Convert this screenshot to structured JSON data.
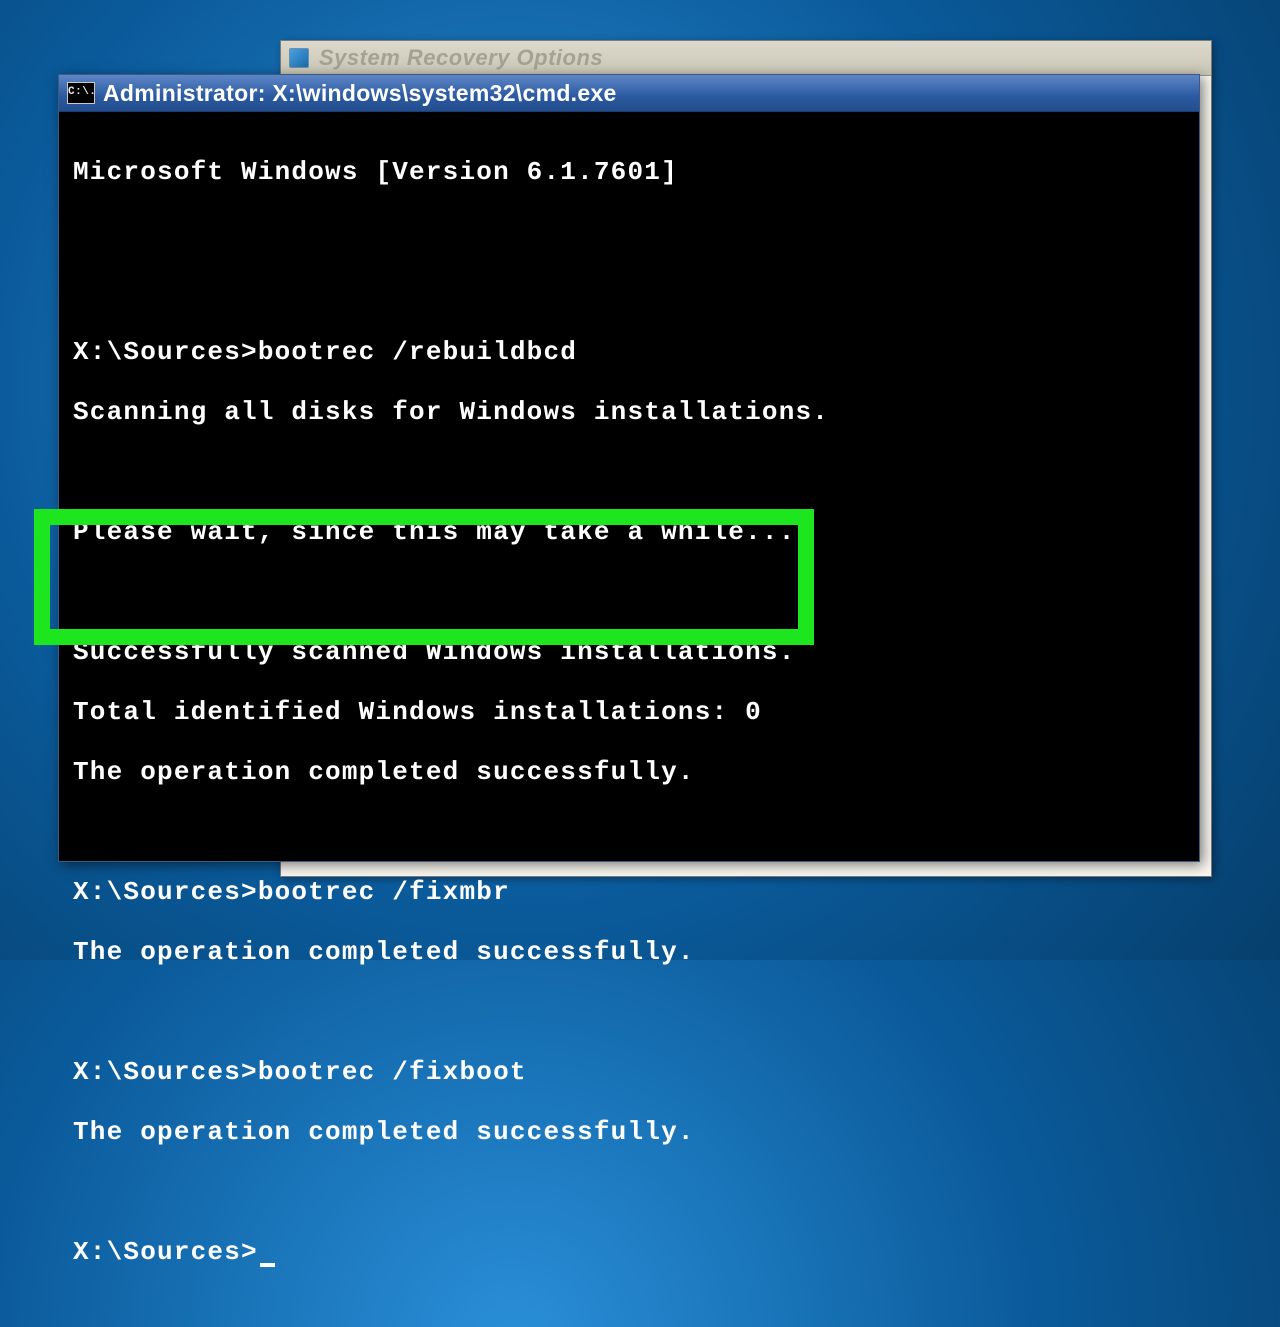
{
  "background_window": {
    "title": "System Recovery Options"
  },
  "cmd_window": {
    "icon_text": "C:\\.",
    "title": "Administrator: X:\\windows\\system32\\cmd.exe"
  },
  "terminal": {
    "lines": [
      "Microsoft Windows [Version 6.1.7601]",
      "",
      "",
      "X:\\Sources>bootrec /rebuildbcd",
      "Scanning all disks for Windows installations.",
      "",
      "Please wait, since this may take a while...",
      "",
      "Successfully scanned Windows installations.",
      "Total identified Windows installations: 0",
      "The operation completed successfully.",
      "",
      "X:\\Sources>bootrec /fixmbr",
      "The operation completed successfully.",
      "",
      "X:\\Sources>bootrec /fixboot",
      "The operation completed successfully.",
      "",
      "X:\\Sources>"
    ],
    "prompt": "X:\\Sources>"
  },
  "colors": {
    "highlight": "#1ee61e",
    "desktop_gradient_from": "#2a8fd8",
    "desktop_gradient_to": "#063f6d",
    "cmd_titlebar": "#2b5aa0"
  }
}
